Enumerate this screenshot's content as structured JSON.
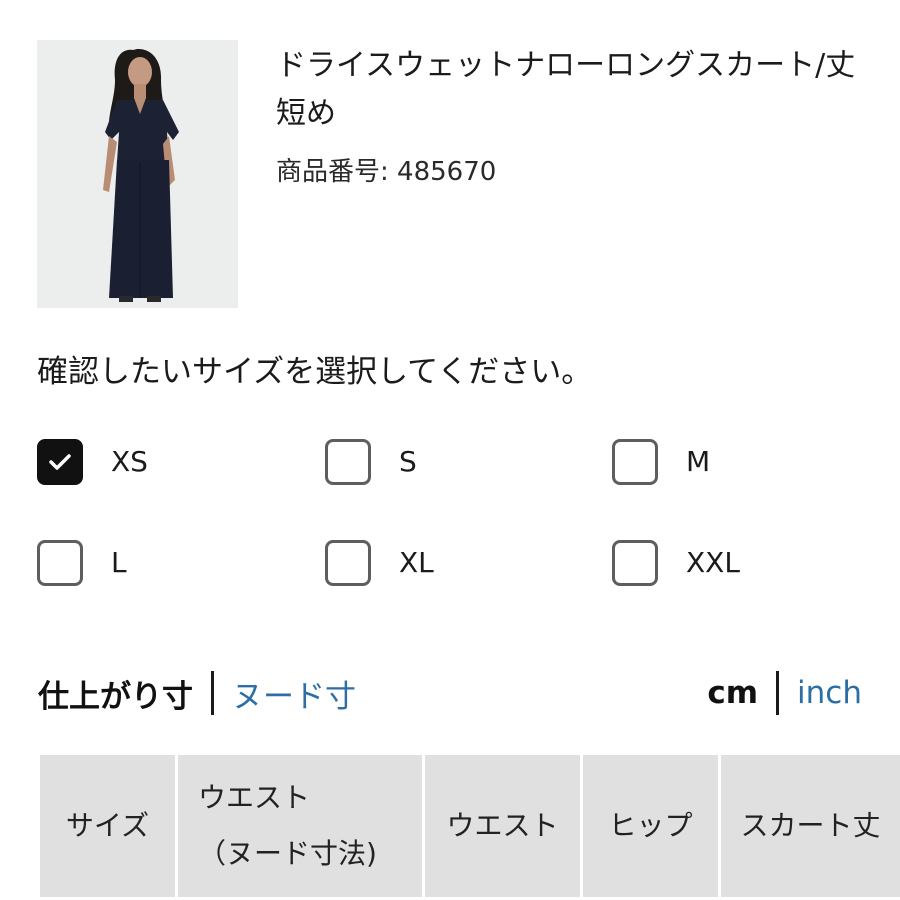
{
  "product": {
    "title": "ドライスウェットナローロングスカート/丈短め",
    "number_label": "商品番号: 485670"
  },
  "size_selector": {
    "prompt": "確認したいサイズを選択してください。",
    "options": [
      {
        "label": "XS",
        "checked": true
      },
      {
        "label": "S",
        "checked": false
      },
      {
        "label": "M",
        "checked": false
      },
      {
        "label": "L",
        "checked": false
      },
      {
        "label": "XL",
        "checked": false
      },
      {
        "label": "XXL",
        "checked": false
      }
    ]
  },
  "measure_toggle": {
    "active": "仕上がり寸",
    "inactive": "ヌード寸"
  },
  "unit_toggle": {
    "active": "cm",
    "inactive": "inch"
  },
  "table": {
    "headers": [
      "サイズ",
      "ウエスト\n（ヌード寸法)",
      "ウエスト",
      "ヒップ",
      "スカート丈"
    ]
  },
  "colors": {
    "link": "#2d6ea5",
    "checked": "#111111",
    "header_bg": "#e0e0e0"
  }
}
